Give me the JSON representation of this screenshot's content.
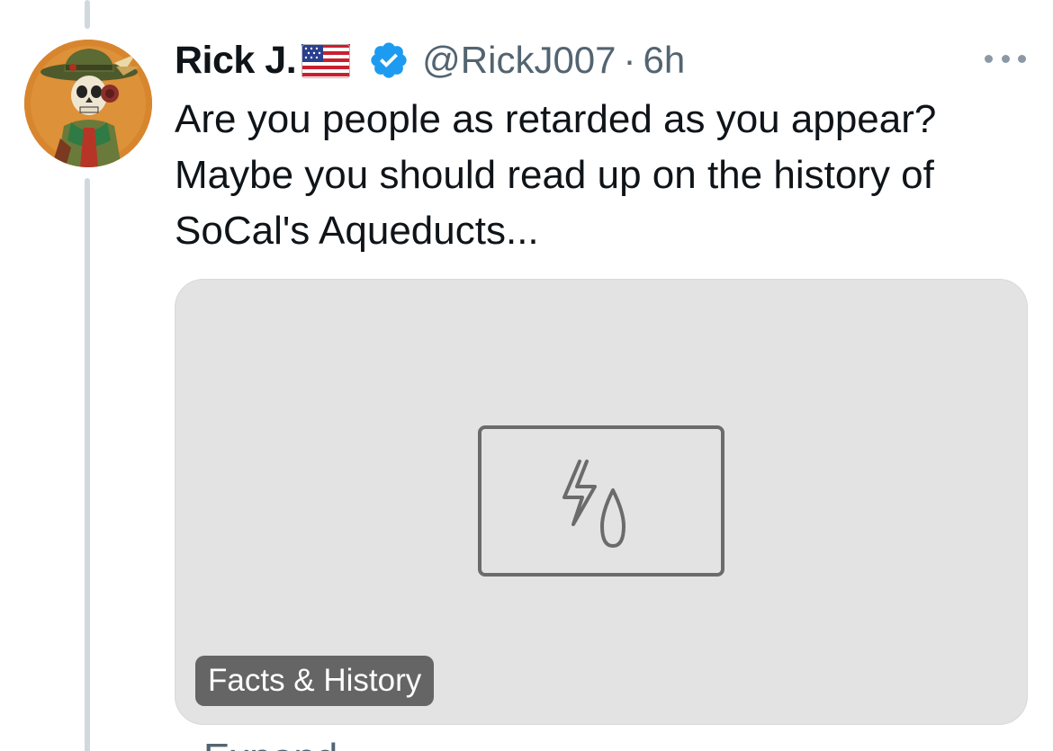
{
  "tweet": {
    "display_name": "Rick J.",
    "handle": "@RickJ007",
    "separator": "·",
    "time": "6h",
    "text_lines": [
      "Are you people as retarded as you appear?",
      "Maybe you should read up on the history of",
      "SoCal's Aqueducts..."
    ],
    "card": {
      "badge": "Facts & History",
      "icon": "lightning-water-drop-icon"
    },
    "bottom_peek": "Expand"
  },
  "icons": {
    "flag": "us-flag-emoji",
    "verified": "verified-badge-icon",
    "more": "more-options-icon"
  },
  "colors": {
    "accent": "#1d9bf0",
    "secondary_text": "#536471",
    "card_bg": "#e3e3e3",
    "thread_line": "#cfd9de"
  }
}
